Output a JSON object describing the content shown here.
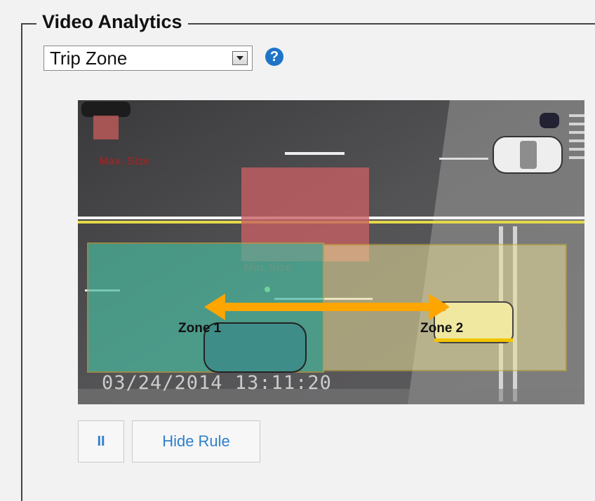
{
  "panel": {
    "title": "Video Analytics"
  },
  "analytics_select": {
    "value": "Trip Zone"
  },
  "help": {
    "glyph": "?"
  },
  "video": {
    "zones": [
      {
        "name": "Zone 1",
        "color": "#49b89e"
      },
      {
        "name": "Zone 2",
        "color": "#e8df9a"
      }
    ],
    "arrow_color": "#ffa500",
    "timestamp": "03/24/2014   13:11:20"
  },
  "controls": {
    "pause_glyph": "II",
    "hide_rule_label": "Hide Rule"
  }
}
